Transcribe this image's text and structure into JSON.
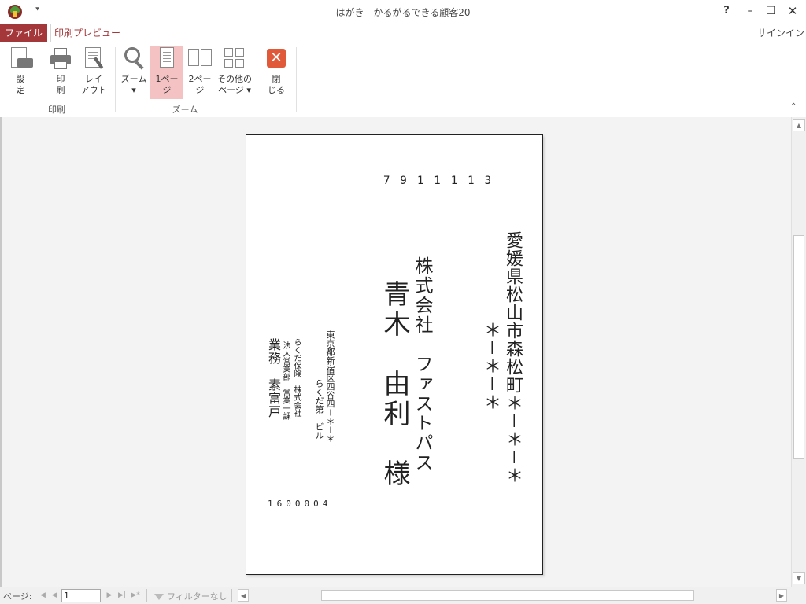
{
  "window": {
    "title": "はがき - かるがるできる顧客20",
    "qat_dropdown": "⯆",
    "help": "?",
    "minimize": "–",
    "maximize": "☐",
    "close": "✕",
    "signin": "サインイン"
  },
  "tabs": {
    "file": "ファイル",
    "print_preview": "印刷プレビュー"
  },
  "ribbon": {
    "print_group": {
      "label": "印刷",
      "settings": "設\n定",
      "print": "印\n刷",
      "layout": "レイ\nアウト"
    },
    "zoom_group": {
      "label": "ズーム",
      "zoom": "ズーム\n▾",
      "one_page": "1ペー\nジ",
      "two_pages": "2ペー\nジ",
      "more_pages": "その他の\nページ ▾"
    },
    "close_group": {
      "close": "閉\nじる"
    },
    "collapse": "⌃"
  },
  "postcard": {
    "to_zip": "7911113",
    "to_address_1": "愛媛県松山市森松町＊－＊－＊",
    "to_address_2": "＊－＊－＊",
    "to_company": "株式会社　ファストパス",
    "to_name": "青木　由利　様",
    "from_address_1": "東京都新宿区四谷四－＊－＊",
    "from_address_2": "らくだ第一ビル",
    "from_company": "らくだ保険　株式会社",
    "from_department": "法人営業部　営業一課",
    "from_name": "業務　素富戸",
    "from_zip": "1600004"
  },
  "navigation": {
    "page_label": "ページ:",
    "first": "|◀",
    "prev": "◀",
    "current_page": "1",
    "next": "▶",
    "last": "▶|",
    "new": "▶*",
    "filter": "フィルターなし"
  },
  "scroll": {
    "up": "▲",
    "down": "▼",
    "left": "◀",
    "right": "▶"
  },
  "colors": {
    "accent": "#a4373a",
    "active_button": "#f4c2c2"
  }
}
